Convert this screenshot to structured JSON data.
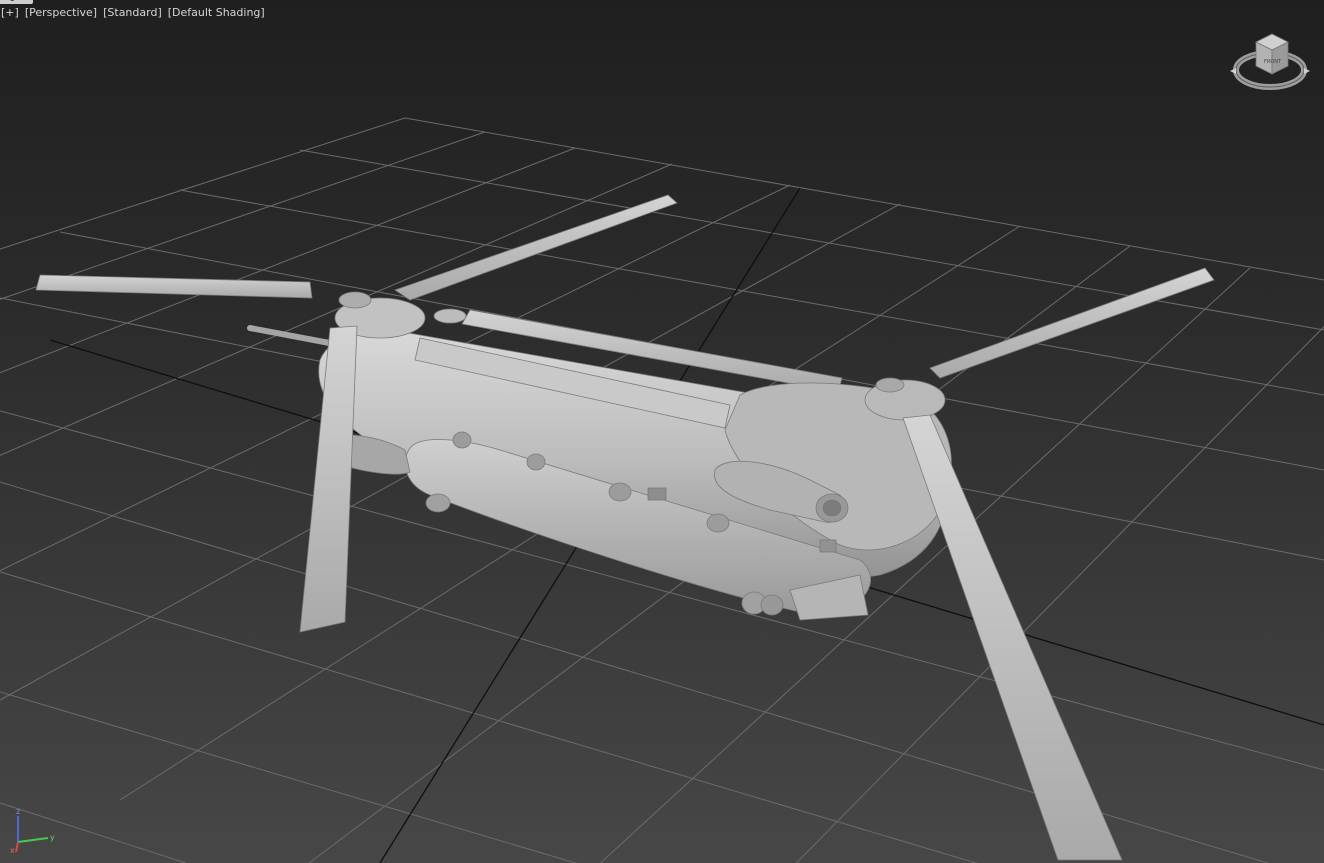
{
  "viewport": {
    "region_tag": "egion",
    "labels": {
      "plus": "[+]",
      "view": "[Perspective]",
      "style": "[Standard]",
      "shading": "[Default Shading]"
    }
  },
  "viewcube": {
    "face_label": "FRONT",
    "icon": "viewcube-icon"
  },
  "axis": {
    "x": "x",
    "y": "y",
    "z": "z",
    "colors": {
      "x": "#d24b4b",
      "y": "#4bc84b",
      "z": "#4b6bd2"
    }
  },
  "colors": {
    "model": "#bdbdbd",
    "grid_line": "#6f6f6f",
    "grid_major": "#111111",
    "background_top": "#1f1f1f",
    "background_bottom": "#474747"
  }
}
